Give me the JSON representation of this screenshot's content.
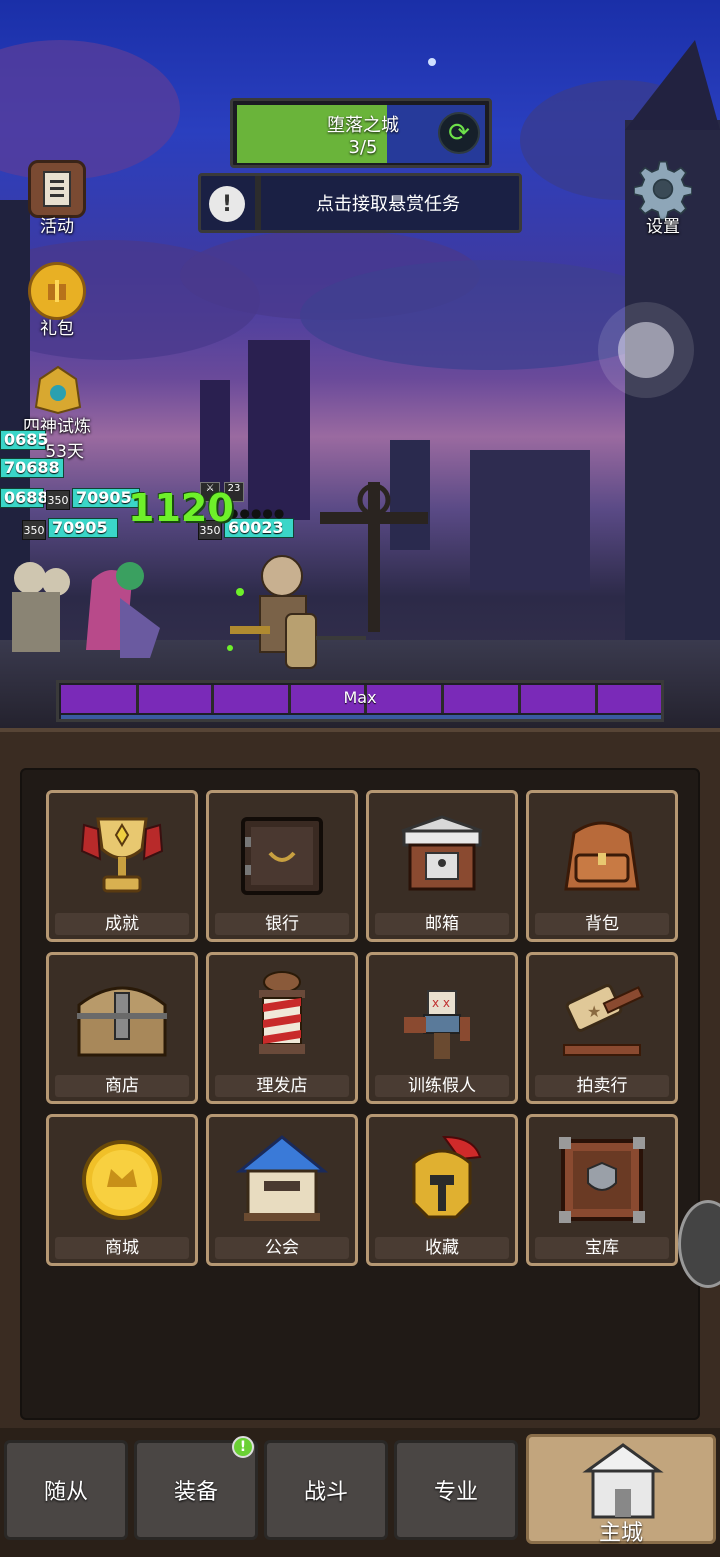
{
  "zone": {
    "name": "堕落之城",
    "progress": "3/5"
  },
  "quest": {
    "text": "点击接取悬赏任务",
    "icon": "exclamation-icon"
  },
  "left_menu": [
    {
      "label": "活动",
      "icon": "event-board-icon"
    },
    {
      "label": "礼包",
      "icon": "gift-coin-icon"
    },
    {
      "label": "四神试炼",
      "icon": "golden-helm-icon"
    }
  ],
  "left_menu_timer": "53天",
  "settings": {
    "label": "设置",
    "icon": "gear-icon"
  },
  "combat": {
    "damage": "1120",
    "buff_level": "23",
    "hp_labels": [
      "0685",
      "70688",
      "0688",
      "70905",
      "70905",
      "60023"
    ],
    "levels": [
      "350",
      "350",
      "350"
    ]
  },
  "energy": {
    "label": "Max",
    "segments": 8,
    "fill": 1.0
  },
  "grid": [
    {
      "label": "成就",
      "icon": "trophy-icon"
    },
    {
      "label": "银行",
      "icon": "vault-icon"
    },
    {
      "label": "邮箱",
      "icon": "mailbox-icon"
    },
    {
      "label": "背包",
      "icon": "backpack-icon"
    },
    {
      "label": "商店",
      "icon": "chest-icon"
    },
    {
      "label": "理发店",
      "icon": "barber-pole-icon"
    },
    {
      "label": "训练假人",
      "icon": "training-dummy-icon"
    },
    {
      "label": "拍卖行",
      "icon": "gavel-icon"
    },
    {
      "label": "商城",
      "icon": "crown-coin-icon"
    },
    {
      "label": "公会",
      "icon": "guild-house-icon"
    },
    {
      "label": "收藏",
      "icon": "spartan-helmet-icon"
    },
    {
      "label": "宝库",
      "icon": "treasury-crate-icon"
    }
  ],
  "nav": [
    {
      "label": "随从"
    },
    {
      "label": "装备",
      "badge": "!"
    },
    {
      "label": "战斗"
    },
    {
      "label": "专业"
    },
    {
      "label": "主城",
      "active": true
    }
  ],
  "colors": {
    "accent_green": "#6ab43a",
    "energy_purple": "#7a2ab8",
    "tile_border": "#b69873"
  }
}
